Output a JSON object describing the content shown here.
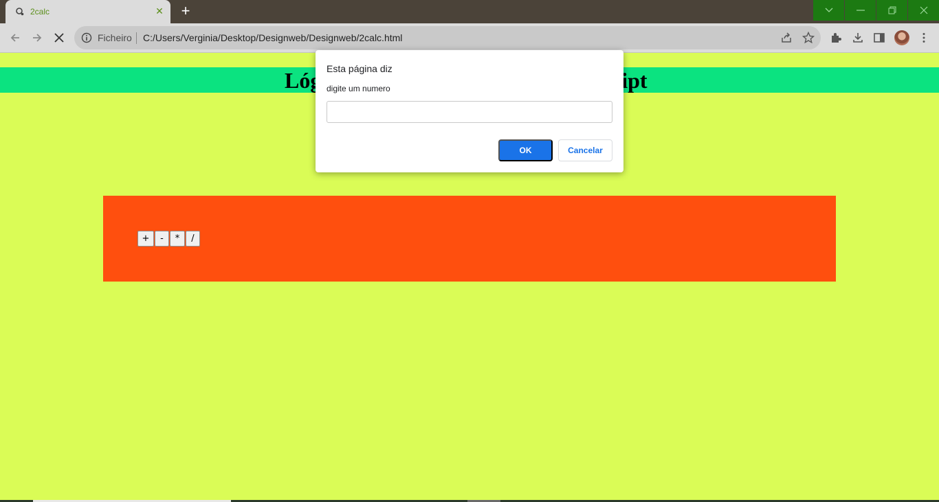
{
  "browser": {
    "tab": {
      "title": "2calc",
      "favicon": "loading-globe-icon",
      "close_icon": "close-icon"
    },
    "new_tab_icon": "plus-icon",
    "window_controls": [
      "chevron-down-icon",
      "minimize-icon",
      "restore-icon",
      "close-icon"
    ],
    "toolbar": {
      "back_icon": "back-arrow-icon",
      "forward_icon": "forward-arrow-icon",
      "stop_icon": "stop-loading-icon",
      "scheme_label": "Ficheiro",
      "url": "C:/Users/Verginia/Desktop/Designweb/Designweb/2calc.html",
      "right_icons": [
        "share-icon",
        "star-icon",
        "extensions-icon",
        "download-icon",
        "side-panel-icon",
        "avatar",
        "more-vert-icon"
      ]
    }
  },
  "page": {
    "heading_left": "Lóg",
    "heading_right": "ript",
    "operators": [
      "+",
      "-",
      "*",
      "/"
    ],
    "colors": {
      "background": "#dafc56",
      "heading_bar": "#0be380",
      "calc_box": "#ff4f0e"
    }
  },
  "dialog": {
    "title": "Esta página diz",
    "message": "digite um numero",
    "input_value": "",
    "ok_label": "OK",
    "cancel_label": "Cancelar"
  }
}
